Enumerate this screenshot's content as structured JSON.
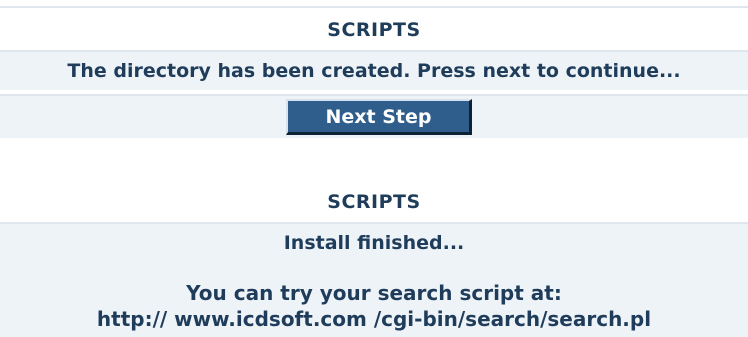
{
  "panel1": {
    "title": "SCRIPTS",
    "message": "The directory has been created. Press next to continue...",
    "next_button_label": "Next Step"
  },
  "panel2": {
    "title": "SCRIPTS",
    "status": "Install finished...",
    "try_text": "You can try your search script at:",
    "script_url": "http:// www.icdsoft.com /cgi-bin/search/search.pl"
  }
}
